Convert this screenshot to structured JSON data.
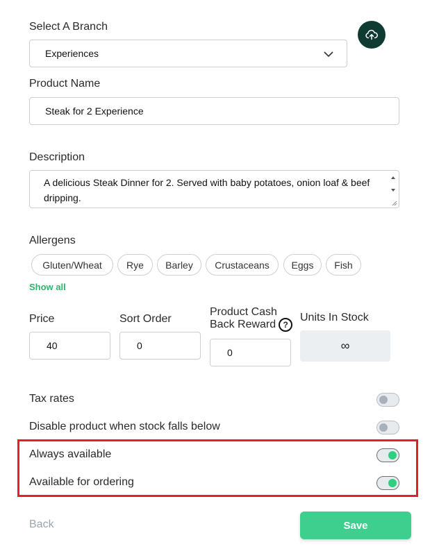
{
  "branch": {
    "label": "Select A Branch",
    "value": "Experiences"
  },
  "product_name": {
    "label": "Product Name",
    "value": "Steak for 2 Experience"
  },
  "description": {
    "label": "Description",
    "value": "A delicious Steak Dinner for 2. Served with baby potatoes, onion loaf & beef dripping."
  },
  "allergens": {
    "label": "Allergens",
    "items": [
      "Gluten/Wheat",
      "Rye",
      "Barley",
      "Crustaceans",
      "Eggs",
      "Fish"
    ],
    "show_all": "Show all"
  },
  "price": {
    "label": "Price",
    "value": "40"
  },
  "sort_order": {
    "label": "Sort Order",
    "value": "0"
  },
  "cashback": {
    "label_line1": "Product Cash",
    "label_line2": "Back Reward",
    "help": "?",
    "value": "0"
  },
  "units": {
    "label": "Units In Stock",
    "value": "∞"
  },
  "toggles": [
    {
      "label": "Tax rates",
      "on": false
    },
    {
      "label": "Disable product when stock falls below",
      "on": false
    },
    {
      "label": "Always available",
      "on": true
    },
    {
      "label": "Available for ordering",
      "on": true
    }
  ],
  "actions": {
    "back": "Back",
    "save": "Save"
  },
  "colors": {
    "accent": "#3ecf8e",
    "dark": "#103b33",
    "highlight": "#e0202a"
  }
}
